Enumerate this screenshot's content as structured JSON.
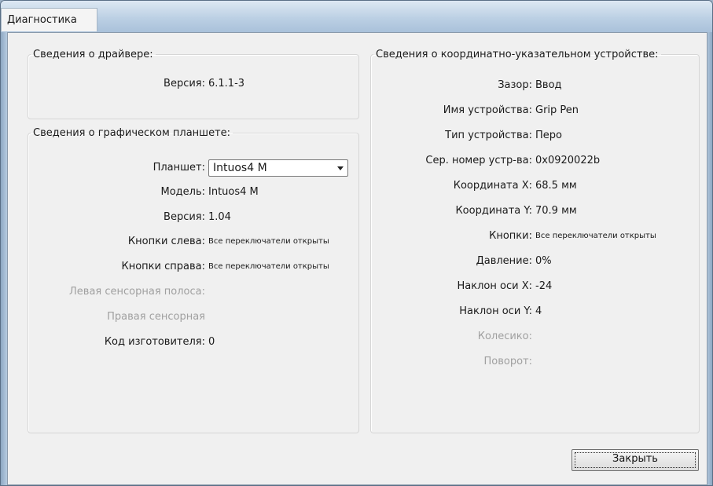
{
  "window": {
    "title": "Диагностика"
  },
  "driver": {
    "legend": "Сведения о драйвере:",
    "version_label": "Версия:",
    "version_value": "6.1.1-3"
  },
  "tablet": {
    "legend": "Сведения о графическом планшете:",
    "tablet_label": "Планшет:",
    "tablet_selected": "Intuos4 M",
    "model_label": "Модель:",
    "model_value": "Intuos4 M",
    "version_label": "Версия:",
    "version_value": "1.04",
    "left_buttons_label": "Кнопки слева:",
    "left_buttons_value": "Все переключатели открыты",
    "right_buttons_label": "Кнопки справа:",
    "right_buttons_value": "Все переключатели открыты",
    "left_touchstrip_label": "Левая сенсорная полоса:",
    "right_touchstrip_label": "Правая сенсорная",
    "vendor_label": "Код изготовителя:",
    "vendor_value": "0"
  },
  "pointing": {
    "legend": "Сведения о координатно-указательном устройстве:",
    "rows": [
      {
        "label": "Зазор:",
        "value": "Ввод"
      },
      {
        "label": "Имя устройства:",
        "value": "Grip Pen"
      },
      {
        "label": "Тип устройства:",
        "value": "Перо"
      },
      {
        "label": "Сер. номер устр-ва:",
        "value": "0x0920022b"
      },
      {
        "label": "Координата X:",
        "value": "68.5 мм"
      },
      {
        "label": "Координата Y:",
        "value": "70.9 мм"
      },
      {
        "label": "Кнопки:",
        "value": "Все переключатели открыты"
      },
      {
        "label": "Давление:",
        "value": "0%"
      },
      {
        "label": "Наклон оси X:",
        "value": "-24"
      },
      {
        "label": "Наклон оси Y:",
        "value": "4"
      },
      {
        "label": "Колесико:",
        "value": ""
      },
      {
        "label": "Поворот:",
        "value": ""
      }
    ]
  },
  "buttons": {
    "close": "Закрыть"
  }
}
